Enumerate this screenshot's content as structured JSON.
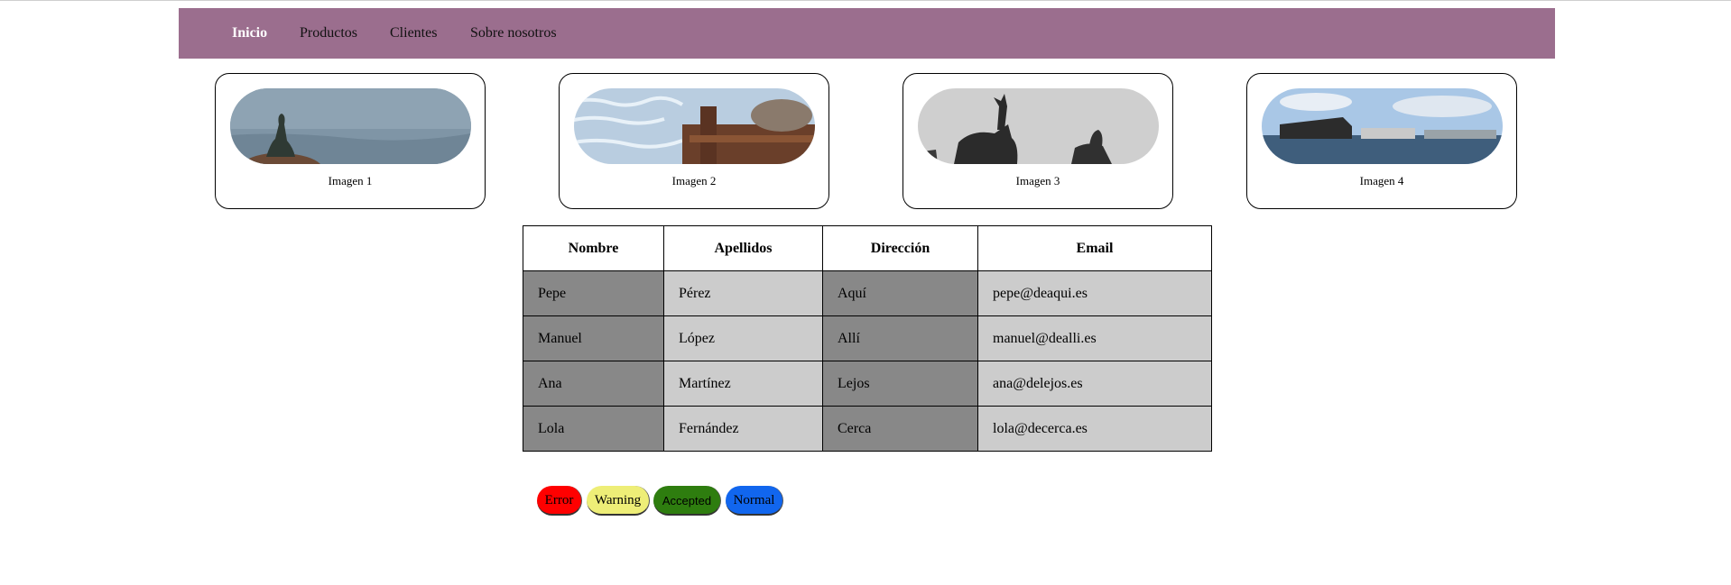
{
  "nav": {
    "items": [
      {
        "label": "Inicio",
        "active": true
      },
      {
        "label": "Productos"
      },
      {
        "label": "Clientes"
      },
      {
        "label": "Sobre nosotros"
      }
    ]
  },
  "gallery": [
    {
      "caption": "Imagen 1",
      "image": "little-mermaid-statue-photo"
    },
    {
      "caption": "Imagen 2",
      "image": "rusty-harbor-bollard-photo"
    },
    {
      "caption": "Imagen 3",
      "image": "don-quixote-statue-photo"
    },
    {
      "caption": "Imagen 4",
      "image": "opera-house-waterfront-photo"
    }
  ],
  "table": {
    "headers": [
      "Nombre",
      "Apellidos",
      "Dirección",
      "Email"
    ],
    "rows": [
      [
        "Pepe",
        "Pérez",
        "Aquí",
        "pepe@deaqui.es"
      ],
      [
        "Manuel",
        "López",
        "Allí",
        "manuel@dealli.es"
      ],
      [
        "Ana",
        "Martínez",
        "Lejos",
        "ana@delejos.es"
      ],
      [
        "Lola",
        "Fernández",
        "Cerca",
        "lola@decerca.es"
      ]
    ]
  },
  "badges": [
    {
      "label": "Error",
      "color": "#ff0000"
    },
    {
      "label": "Warning",
      "color": "#eeee77"
    },
    {
      "label": "Accepted",
      "color": "#2e7d0f"
    },
    {
      "label": "Normal",
      "color": "#1166ee"
    }
  ],
  "colors": {
    "navbar": "#9b6e8e",
    "nav_active": "#ffffff",
    "cell_dark": "#888888",
    "cell_light": "#cccccc"
  }
}
